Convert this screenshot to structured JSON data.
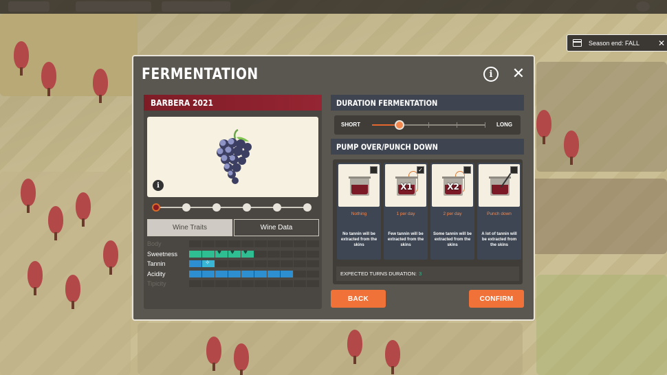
{
  "hud": {
    "season_label": "Season end: FALL",
    "close_glyph": "✕",
    "calendar_icon": "calendar-icon"
  },
  "modal": {
    "title": "FERMENTATION",
    "info_glyph": "i",
    "close_glyph": "✕"
  },
  "wine": {
    "name": "BARBERA 2021",
    "grape_icon": "grape-icon",
    "info_glyph": "i",
    "vintage_dots": 6,
    "active_vintage_index": 0
  },
  "tabs": [
    {
      "label": "Wine Traits",
      "active": true
    },
    {
      "label": "Wine Data",
      "active": false
    }
  ],
  "traits": [
    {
      "label": "Body",
      "enabled": false,
      "green": 0,
      "hearts": 0,
      "blue": 0,
      "stars": 0
    },
    {
      "label": "Sweetness",
      "enabled": true,
      "green": 2,
      "hearts": 3,
      "blue": 0,
      "stars": 0
    },
    {
      "label": "Tannin",
      "enabled": true,
      "green": 0,
      "hearts": 0,
      "blue": 1,
      "stars": 1
    },
    {
      "label": "Acidity",
      "enabled": true,
      "green": 0,
      "hearts": 0,
      "blue": 8,
      "stars": 0
    },
    {
      "label": "Tipicity",
      "enabled": false,
      "green": 0,
      "hearts": 0,
      "blue": 0,
      "stars": 0
    }
  ],
  "duration": {
    "header": "DURATION FERMENTATION",
    "min_label": "SHORT",
    "max_label": "LONG",
    "steps": 5,
    "selected_step": 1,
    "colors": {
      "accent": "#e5672e",
      "track": "#8c8880"
    }
  },
  "pump": {
    "header": "PUMP OVER/PUNCH DOWN",
    "options": [
      {
        "name": "Nothing",
        "multiplier": "",
        "description": "No tannin will be extracted from the skins",
        "checked": false,
        "icon": "tank-icon"
      },
      {
        "name": "1 per day",
        "multiplier": "X1",
        "description": "Few tannin will be extracted from the skins",
        "checked": true,
        "icon": "pump-over-icon"
      },
      {
        "name": "2 per day",
        "multiplier": "X2",
        "description": "Some tannin will be extracted from the skins",
        "checked": false,
        "icon": "pump-over-icon"
      },
      {
        "name": "Punch down",
        "multiplier": "",
        "description": "A lot of tannin will be extracted from the skins",
        "checked": false,
        "icon": "punch-down-icon"
      }
    ]
  },
  "expected": {
    "label": "EXPECTED TURNS DURATION:",
    "value": "3"
  },
  "buttons": {
    "back": "BACK",
    "confirm": "CONFIRM"
  }
}
